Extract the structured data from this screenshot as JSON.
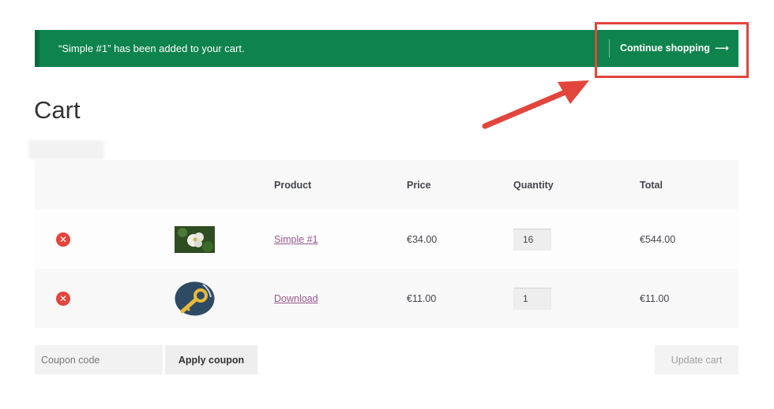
{
  "notice": {
    "message": "“Simple #1” has been added to your cart.",
    "continue_label": "Continue shopping",
    "continue_arrow": "⟶"
  },
  "page": {
    "title": "Cart"
  },
  "table": {
    "headers": [
      "",
      "",
      "Product",
      "Price",
      "Quantity",
      "Total"
    ],
    "rows": [
      {
        "name": "Simple #1",
        "price": "€34.00",
        "quantity": "16",
        "total": "€544.00",
        "thumb_icon": "flower-photo-icon"
      },
      {
        "name": "Download",
        "price": "€11.00",
        "quantity": "1",
        "total": "€11.00",
        "thumb_icon": "key-icon"
      }
    ],
    "remove_glyph": "✕"
  },
  "coupon": {
    "placeholder": "Coupon code",
    "apply_label": "Apply coupon"
  },
  "update_label": "Update cart",
  "colors": {
    "notice_bg": "#0f834d",
    "highlight": "#e2453c",
    "link": "#96588a"
  }
}
